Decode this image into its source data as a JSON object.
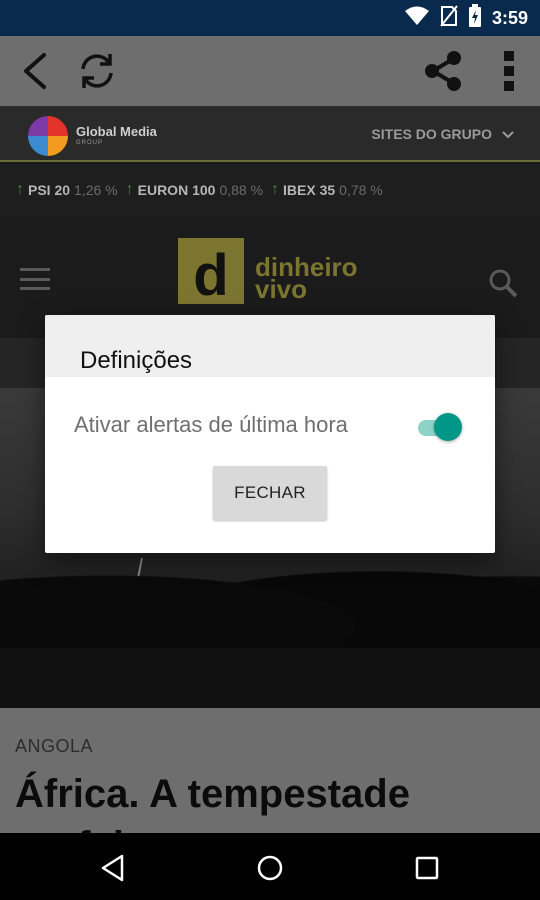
{
  "status_bar": {
    "time": "3:59",
    "icons": [
      "wifi-icon",
      "no-sim-icon",
      "battery-charging-icon"
    ]
  },
  "toolbar": {
    "icons": [
      "back-arrow-icon",
      "refresh-icon",
      "share-icon",
      "overflow-menu-icon"
    ]
  },
  "web": {
    "group_bar": {
      "logo_name": "Global Media",
      "logo_sub": "GROUP",
      "sites_label": "SITES DO GRUPO"
    },
    "ticker": [
      {
        "name": "PSI 20",
        "value": "1,26 %"
      },
      {
        "name": "EURON 100",
        "value": "0,88 %"
      },
      {
        "name": "IBEX 35",
        "value": "0,78 %"
      }
    ],
    "site_logo": {
      "letter": "d",
      "word1": "dinheiro",
      "word2": "vivo"
    },
    "article": {
      "category": "ANGOLA",
      "title": "África. A tempestade perfeita para os"
    }
  },
  "dialog": {
    "title": "Definições",
    "toggle_label": "Ativar alertas de última hora",
    "toggle_on": true,
    "close_button": "FECHAR",
    "accent_color": "#009688"
  },
  "nav_bar": {
    "icons": [
      "back-triangle-icon",
      "home-circle-icon",
      "recents-square-icon"
    ]
  }
}
